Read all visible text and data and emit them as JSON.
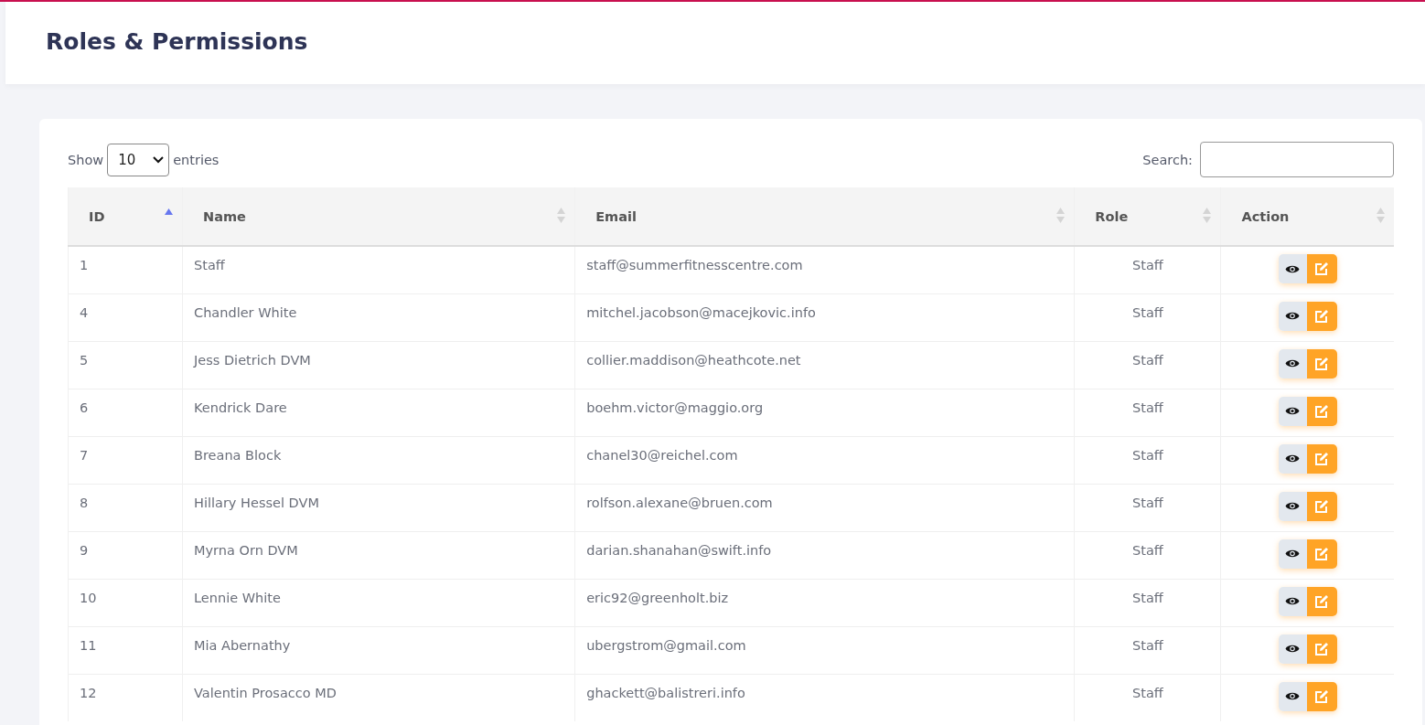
{
  "page_title": "Roles & Permissions",
  "length_menu": {
    "show_label": "Show",
    "value": "10",
    "entries_label": "entries"
  },
  "search": {
    "label": "Search:"
  },
  "table": {
    "columns": [
      {
        "label": "ID",
        "sorted": true
      },
      {
        "label": "Name",
        "sorted": false
      },
      {
        "label": "Email",
        "sorted": false
      },
      {
        "label": "Role",
        "sorted": false
      },
      {
        "label": "Action",
        "sorted": false
      }
    ],
    "rows": [
      {
        "id": "1",
        "name": "Staff",
        "email": "staff@summerfitnesscentre.com",
        "role": "Staff"
      },
      {
        "id": "4",
        "name": "Chandler White",
        "email": "mitchel.jacobson@macejkovic.info",
        "role": "Staff"
      },
      {
        "id": "5",
        "name": "Jess Dietrich DVM",
        "email": "collier.maddison@heathcote.net",
        "role": "Staff"
      },
      {
        "id": "6",
        "name": "Kendrick Dare",
        "email": "boehm.victor@maggio.org",
        "role": "Staff"
      },
      {
        "id": "7",
        "name": "Breana Block",
        "email": "chanel30@reichel.com",
        "role": "Staff"
      },
      {
        "id": "8",
        "name": "Hillary Hessel DVM",
        "email": "rolfson.alexane@bruen.com",
        "role": "Staff"
      },
      {
        "id": "9",
        "name": "Myrna Orn DVM",
        "email": "darian.shanahan@swift.info",
        "role": "Staff"
      },
      {
        "id": "10",
        "name": "Lennie White",
        "email": "eric92@greenholt.biz",
        "role": "Staff"
      },
      {
        "id": "11",
        "name": "Mia Abernathy",
        "email": "ubergstrom@gmail.com",
        "role": "Staff"
      },
      {
        "id": "12",
        "name": "Valentin Prosacco MD",
        "email": "ghackett@balistreri.info",
        "role": "Staff"
      }
    ]
  }
}
